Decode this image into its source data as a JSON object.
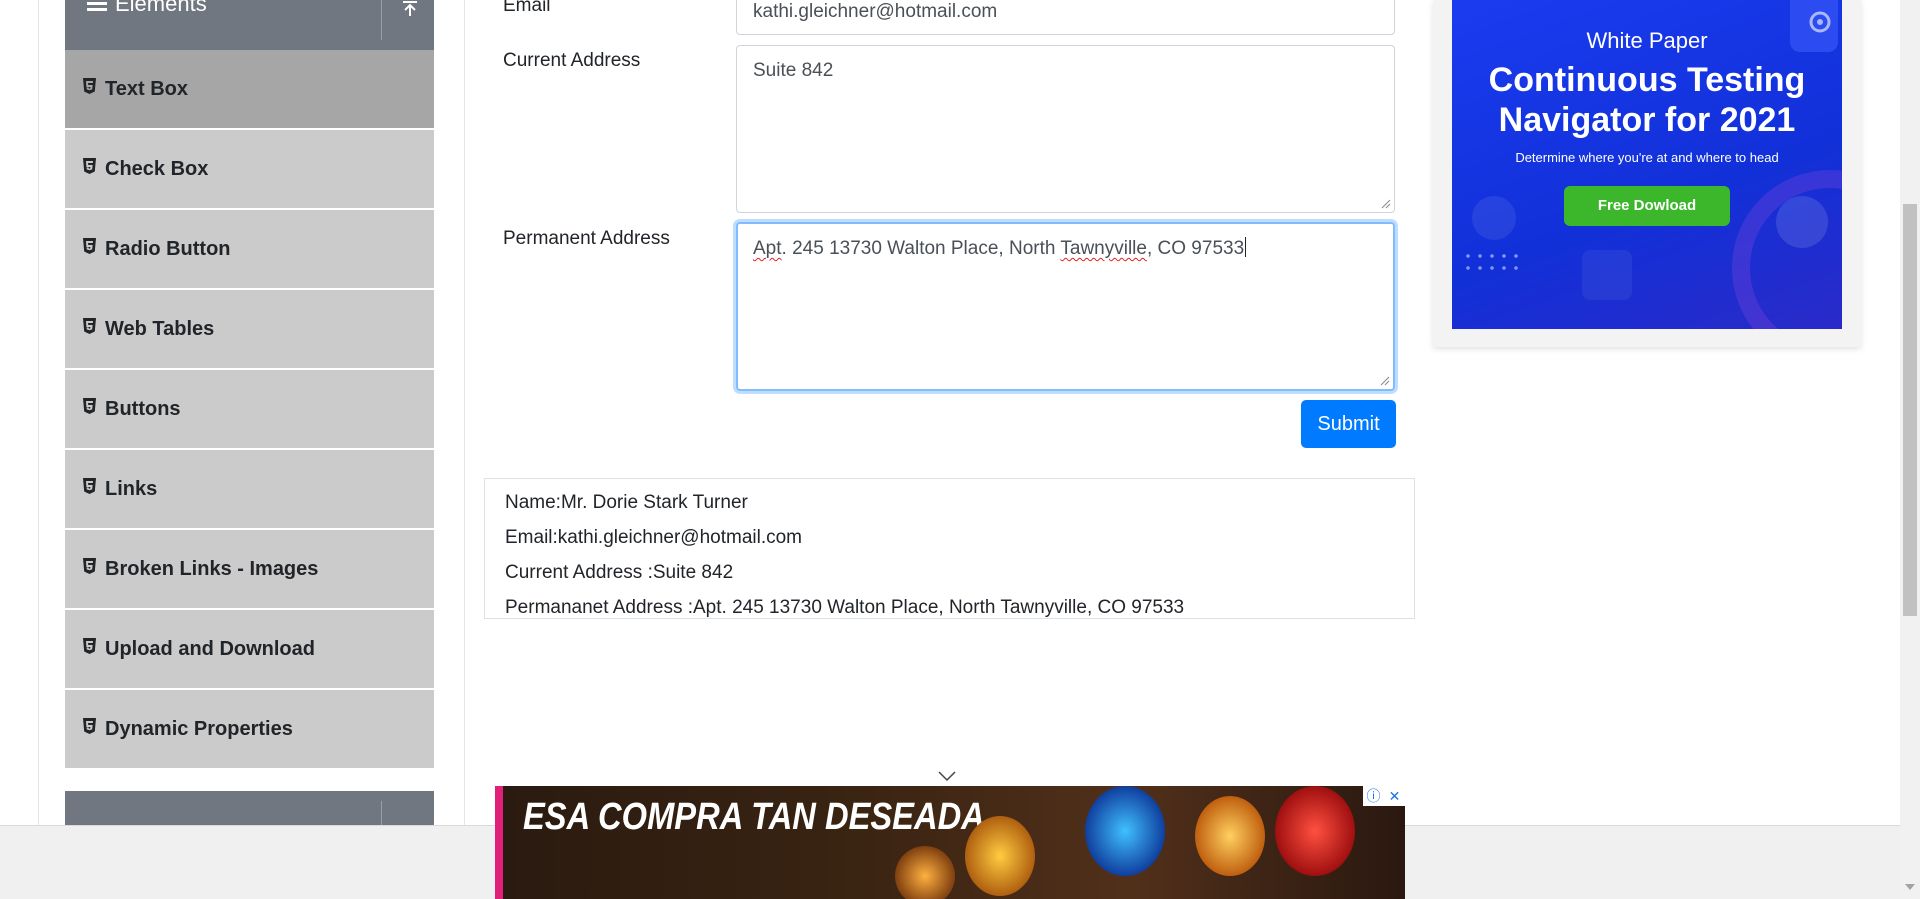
{
  "sidebar": {
    "group_title": "Elements",
    "items": [
      {
        "label": "Text Box"
      },
      {
        "label": "Check Box"
      },
      {
        "label": "Radio Button"
      },
      {
        "label": "Web Tables"
      },
      {
        "label": "Buttons"
      },
      {
        "label": "Links"
      },
      {
        "label": "Broken Links - Images"
      },
      {
        "label": "Upload and Download"
      },
      {
        "label": "Dynamic Properties"
      }
    ]
  },
  "form": {
    "email_label": "Email",
    "email_value": "kathi.gleichner@hotmail.com",
    "current_address_label": "Current Address",
    "current_address_value": "Suite 842",
    "permanent_address_label": "Permanent Address",
    "permanent_address_words": {
      "w1": "Apt",
      "w2": ". 245 13730 Walton Place, North ",
      "w3": "Tawnyville",
      "w4": ", CO 97533"
    },
    "submit_label": "Submit"
  },
  "output": {
    "name": "Name:Mr. Dorie Stark Turner",
    "email": "Email:kathi.gleichner@hotmail.com",
    "current_address": "Current Address :Suite 842",
    "permanent_address": "Permananet Address :Apt. 245 13730 Walton Place, North Tawnyville, CO 97533"
  },
  "ad_right": {
    "kicker": "White Paper",
    "headline_line1": "Continuous Testing",
    "headline_line2": "Navigator for 2021",
    "subtext": "Determine where you're at and where to head",
    "cta": "Free Dowload"
  },
  "ad_bottom": {
    "headline": "ESA COMPRA TAN DESEADA",
    "info_glyph": "ⓘ",
    "close_glyph": "✕"
  },
  "colors": {
    "primary_button": "#007bff",
    "sidebar_header": "#707780",
    "menu_item_bg": "#cbcbcb",
    "menu_item_active_bg": "#a6a6a6",
    "ad_blue": "#1a3cf0",
    "ad_cta_green": "#3cb72c"
  },
  "icons": {
    "menu": "hamburger-icon",
    "collapse": "collapse-up-icon",
    "item": "html5-icon",
    "chevron": "chevron-down-icon"
  }
}
